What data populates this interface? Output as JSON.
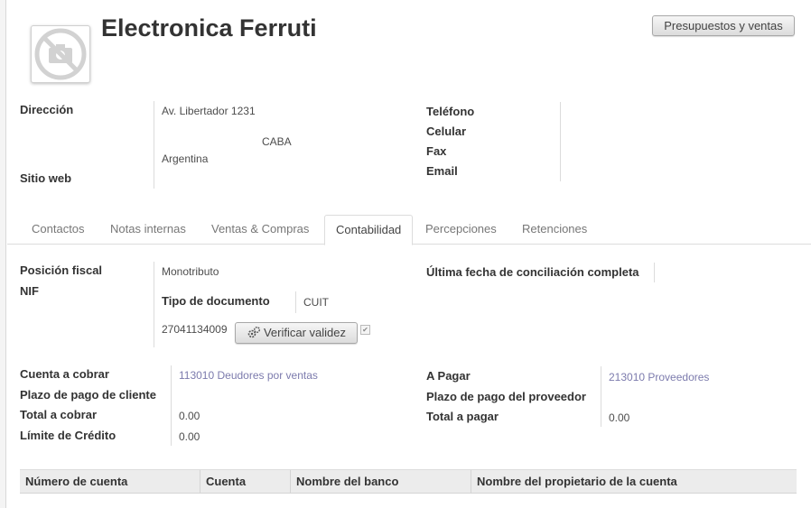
{
  "header": {
    "partner_name": "Electronica Ferruti",
    "quotes_button": "Presupuestos y ventas",
    "avatar_icon": "no-camera-icon"
  },
  "address": {
    "label": "Dirección",
    "street": "Av. Libertador 1231",
    "city": "CABA",
    "country": "Argentina",
    "website_label": "Sitio web"
  },
  "contact": {
    "phone_label": "Teléfono",
    "mobile_label": "Celular",
    "fax_label": "Fax",
    "email_label": "Email"
  },
  "tabs": [
    {
      "label": "Contactos"
    },
    {
      "label": "Notas internas"
    },
    {
      "label": "Ventas & Compras"
    },
    {
      "label": "Contabilidad",
      "active": true
    },
    {
      "label": "Percepciones"
    },
    {
      "label": "Retenciones"
    }
  ],
  "accounting": {
    "fiscal_position_label": "Posición fiscal",
    "fiscal_position_value": "Monotributo",
    "nif_label": "NIF",
    "doc_type_label": "Tipo de documento",
    "doc_type_value": "CUIT",
    "nif_value": "27041134009",
    "verify_button": "Verificar validez",
    "last_reconcile_label": "Última fecha de conciliación completa",
    "receivable_label": "Cuenta a cobrar",
    "receivable_value": "113010 Deudores por ventas",
    "customer_terms_label": "Plazo de pago de cliente",
    "total_receivable_label": "Total a cobrar",
    "total_receivable_value": "0.00",
    "credit_limit_label": "Límite de Crédito",
    "credit_limit_value": "0.00",
    "payable_label": "A Pagar",
    "payable_value": "213010 Proveedores",
    "supplier_terms_label": "Plazo de pago del proveedor",
    "total_payable_label": "Total a pagar",
    "total_payable_value": "0.00"
  },
  "bank_table": {
    "columns": [
      "Número de cuenta",
      "Cuenta",
      "Nombre del banco",
      "Nombre del propietario de la cuenta"
    ]
  }
}
